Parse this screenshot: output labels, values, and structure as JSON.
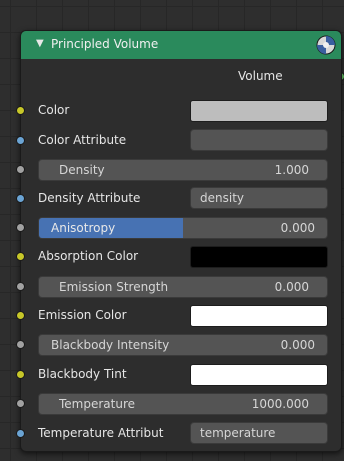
{
  "node": {
    "title": "Principled Volume",
    "header_color": "#2a8a5c",
    "output_label": "Volume",
    "inputs": {
      "color": {
        "label": "Color",
        "swatch": "#bdbdbd"
      },
      "color_attribute": {
        "label": "Color Attribute",
        "value": ""
      },
      "density": {
        "label": "Density",
        "value": "1.000"
      },
      "density_attribute": {
        "label": "Density Attribute",
        "value": "density"
      },
      "anisotropy": {
        "label": "Anisotropy",
        "value": "0.000",
        "fill_fraction": 0.5
      },
      "absorption_color": {
        "label": "Absorption Color",
        "swatch": "#000000"
      },
      "emission_strength": {
        "label": "Emission Strength",
        "value": "0.000"
      },
      "emission_color": {
        "label": "Emission Color",
        "swatch": "#ffffff"
      },
      "blackbody_intensity": {
        "label": "Blackbody Intensity",
        "value": "0.000"
      },
      "blackbody_tint": {
        "label": "Blackbody Tint",
        "swatch": "#ffffff"
      },
      "temperature": {
        "label": "Temperature",
        "value": "1000.000"
      },
      "temperature_attribute": {
        "label": "Temperature Attribut",
        "value": "temperature"
      }
    }
  }
}
